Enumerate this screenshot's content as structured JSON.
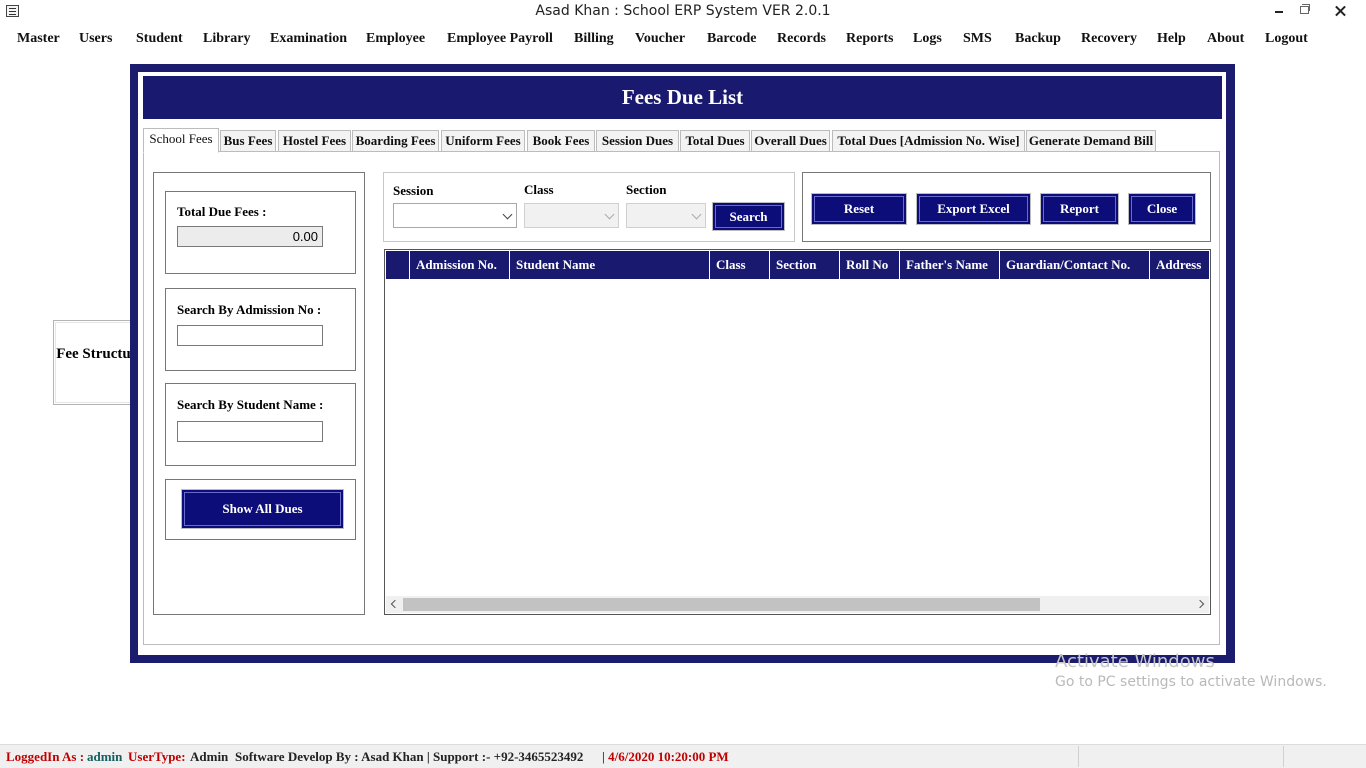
{
  "window": {
    "title": "Asad Khan : School ERP System VER 2.0.1"
  },
  "menu": [
    "Master",
    "Users",
    "Student",
    "Library",
    "Examination",
    "Employee",
    "Employee Payroll",
    "Billing",
    "Voucher",
    "Barcode",
    "Records",
    "Reports",
    "Logs",
    "SMS",
    "Backup",
    "Recovery",
    "Help",
    "About",
    "Logout"
  ],
  "background": {
    "fee_structure_label": "Fee Structure"
  },
  "dialog": {
    "title": "Fees Due List",
    "tabs": [
      "School Fees",
      "Bus Fees",
      "Hostel Fees",
      "Boarding Fees",
      "Uniform Fees",
      "Book Fees",
      "Session Dues",
      "Total Dues",
      "Overall Dues",
      "Total Dues [Admission No. Wise]",
      "Generate Demand Bill"
    ],
    "active_tab": "School Fees",
    "left": {
      "total_due_label": "Total Due Fees :",
      "total_due_value": "0.00",
      "admission_label": "Search By Admission No :",
      "admission_value": "",
      "student_name_label": "Search By Student Name :",
      "student_name_value": "",
      "show_all_dues": "Show All Dues"
    },
    "filters": {
      "session_label": "Session",
      "class_label": "Class",
      "section_label": "Section",
      "session_value": "",
      "class_value": "",
      "section_value": "",
      "search_button": "Search"
    },
    "actions": {
      "reset": "Reset",
      "export_excel": "Export Excel",
      "report": "Report",
      "close": "Close"
    },
    "grid": {
      "columns": [
        "",
        "Admission No.",
        "Student Name",
        "Class",
        "Section",
        "Roll No",
        "Father's Name",
        "Guardian/Contact No.",
        "Address"
      ],
      "rows": []
    }
  },
  "watermark": {
    "line1": "Activate Windows",
    "line2": "Go to PC settings to activate Windows."
  },
  "status": {
    "logged_label": "LoggedIn As :",
    "user": "admin",
    "usertype_label": "UserType:",
    "usertype": "Admin",
    "developer": "Software Develop By : Asad Khan | Support :-  +92-3465523492",
    "datetime": "|  4/6/2020 10:20:00 PM"
  },
  "colors": {
    "navy": "#191970",
    "button": "#0d0d7a",
    "status_red": "#c00000"
  }
}
